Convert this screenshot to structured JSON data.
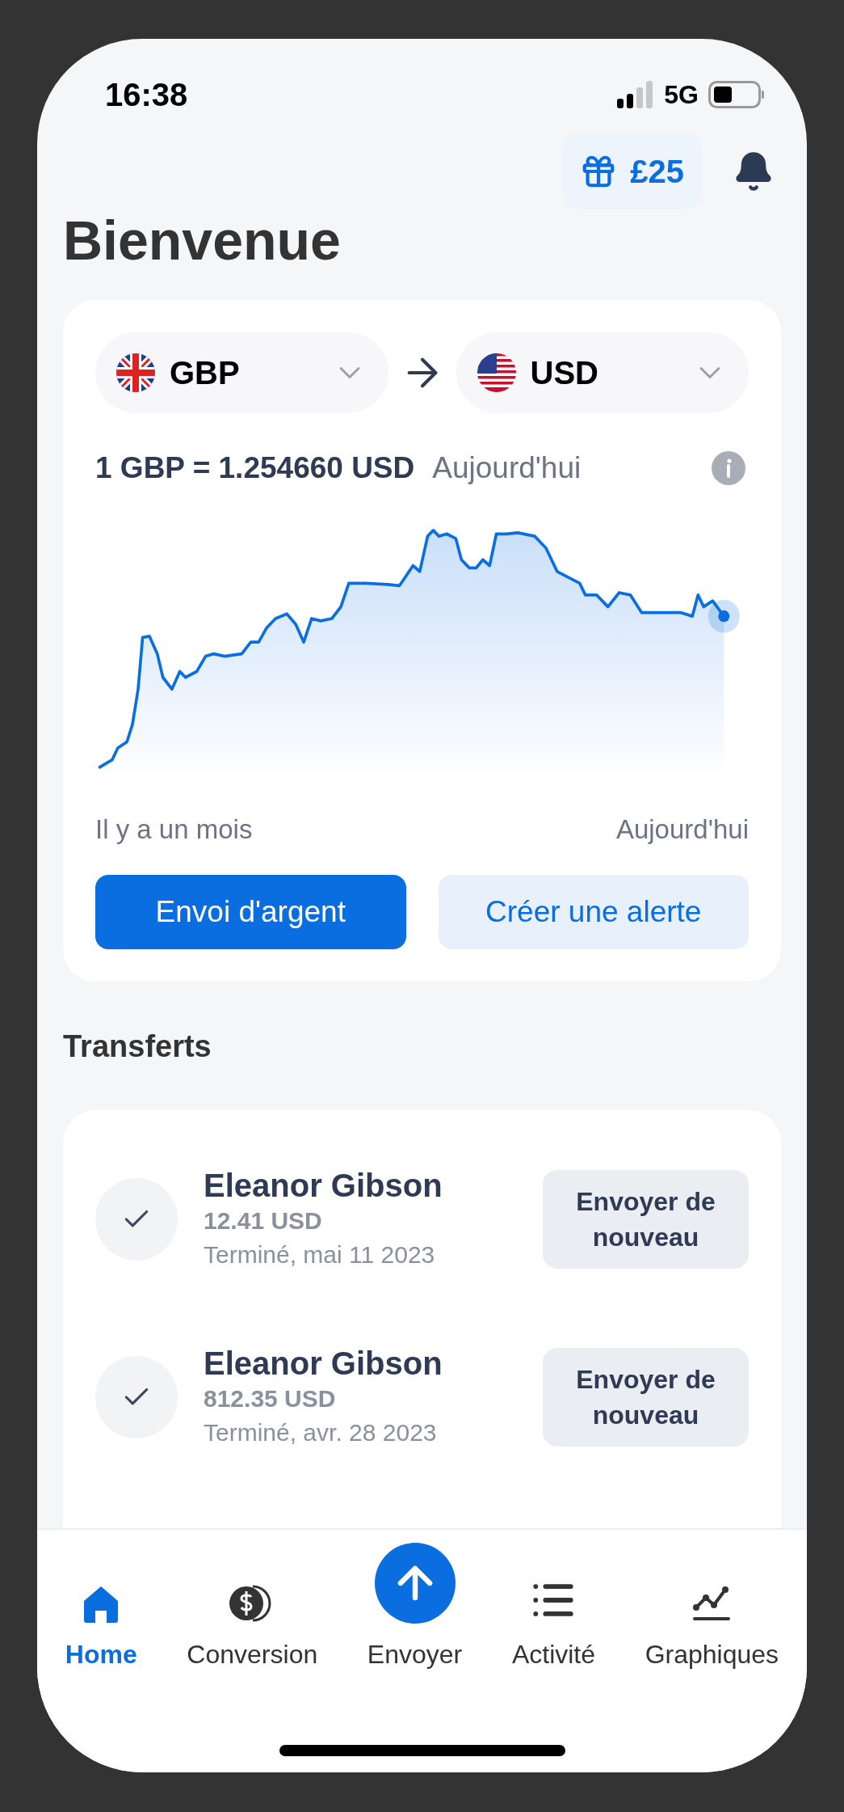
{
  "status_bar": {
    "time": "16:38",
    "network": "5G"
  },
  "header": {
    "reward": "£25",
    "title": "Bienvenue"
  },
  "converter": {
    "from": "GBP",
    "to": "USD",
    "rate": "1 GBP = 1.254660 USD",
    "rate_date": "Aujourd'hui",
    "range_start": "Il y a un mois",
    "range_end": "Aujourd'hui",
    "primary_button": "Envoi d'argent",
    "secondary_button": "Créer une alerte"
  },
  "transfers": {
    "title": "Transferts",
    "items": [
      {
        "name": "Eleanor Gibson",
        "amount": "12.41 USD",
        "status": "Terminé, mai 11 2023",
        "action": "Envoyer de nouveau"
      },
      {
        "name": "Eleanor Gibson",
        "amount": "812.35 USD",
        "status": "Terminé, avr. 28 2023",
        "action": "Envoyer de nouveau"
      }
    ]
  },
  "nav": [
    {
      "label": "Home",
      "kind": "home",
      "selected": true
    },
    {
      "label": "Conversion",
      "kind": "coins",
      "selected": false
    },
    {
      "label": "Envoyer",
      "kind": "send",
      "selected": false
    },
    {
      "label": "Activité",
      "kind": "list",
      "selected": false
    },
    {
      "label": "Graphiques",
      "kind": "chart",
      "selected": false
    }
  ]
}
